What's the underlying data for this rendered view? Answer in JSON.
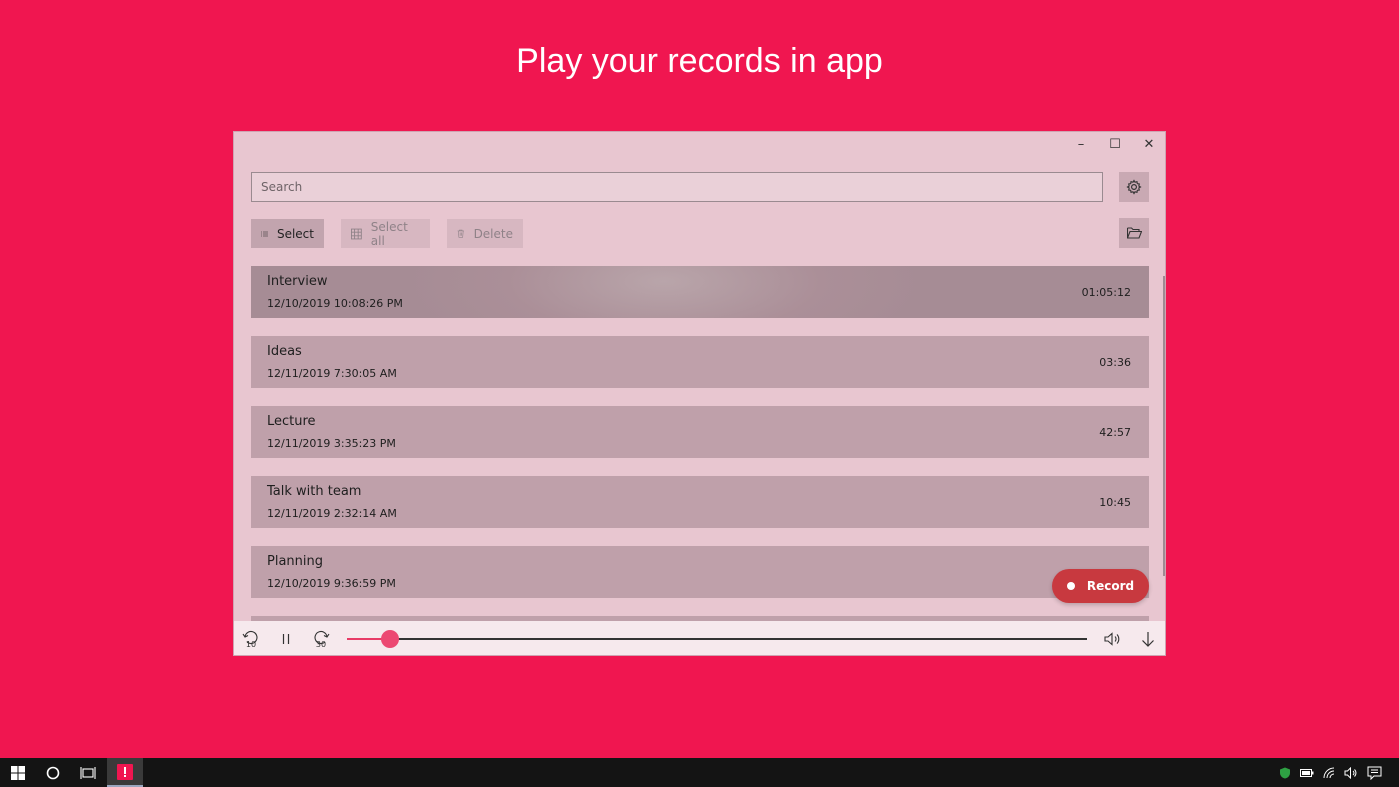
{
  "headline": "Play your records in app",
  "window": {
    "controls": {
      "minimize": "–",
      "maximize": "☐",
      "close": "✕"
    }
  },
  "search": {
    "placeholder": "Search",
    "value": ""
  },
  "toolbar": {
    "select_label": "Select",
    "select_all_label": "Select all",
    "delete_label": "Delete"
  },
  "records": [
    {
      "name": "Interview",
      "date": "12/10/2019 10:08:26 PM",
      "duration": "01:05:12",
      "active": true
    },
    {
      "name": "Ideas",
      "date": "12/11/2019 7:30:05 AM",
      "duration": "03:36"
    },
    {
      "name": "Lecture",
      "date": "12/11/2019 3:35:23 PM",
      "duration": "42:57"
    },
    {
      "name": "Talk with team",
      "date": "12/11/2019 2:32:14 AM",
      "duration": "10:45"
    },
    {
      "name": "Planning",
      "date": "12/10/2019 9:36:59 PM",
      "duration": ""
    }
  ],
  "record_button": {
    "label": "Record"
  },
  "player": {
    "skip_back_seconds": "10",
    "skip_forward_seconds": "30",
    "progress": 0.058
  },
  "colors": {
    "background": "#f01650",
    "accent": "#ec4872",
    "record": "#c8393f"
  },
  "icons": {
    "settings": "gear-icon",
    "folder": "folder-open-icon",
    "select": "list-icon",
    "select_all": "grid-icon",
    "delete": "trash-icon",
    "volume": "volume-icon",
    "download": "arrow-down-icon"
  }
}
